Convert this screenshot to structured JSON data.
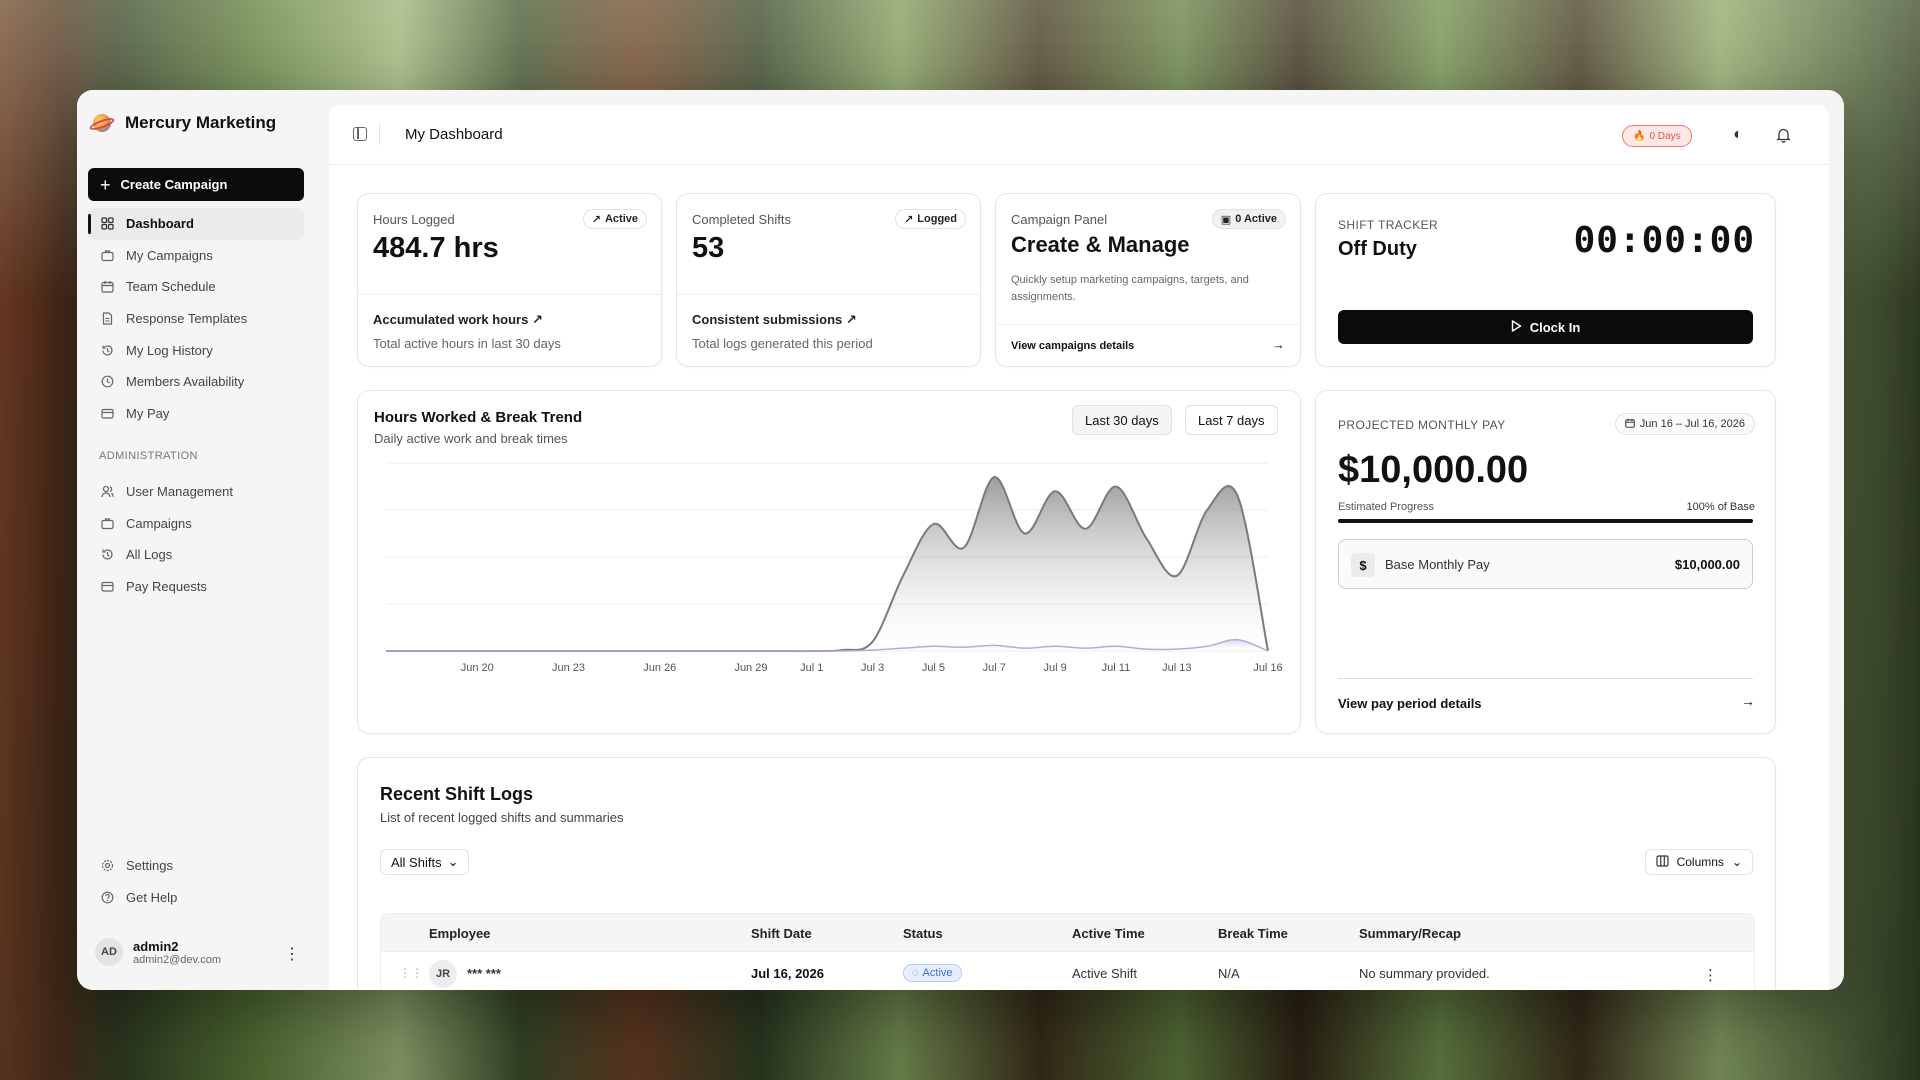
{
  "app": {
    "name": "Mercury Marketing"
  },
  "sidebar": {
    "create_label": "Create Campaign",
    "items": [
      {
        "label": "Dashboard",
        "icon": "grid-icon"
      },
      {
        "label": "My Campaigns",
        "icon": "briefcase-icon"
      },
      {
        "label": "Team Schedule",
        "icon": "calendar-icon"
      },
      {
        "label": "Response Templates",
        "icon": "document-icon"
      },
      {
        "label": "My Log History",
        "icon": "history-icon"
      },
      {
        "label": "Members Availability",
        "icon": "clock-icon"
      },
      {
        "label": "My Pay",
        "icon": "card-icon"
      }
    ],
    "admin_section_label": "ADMINISTRATION",
    "admin_items": [
      {
        "label": "User Management",
        "icon": "users-icon"
      },
      {
        "label": "Campaigns",
        "icon": "briefcase-icon"
      },
      {
        "label": "All Logs",
        "icon": "history-icon"
      },
      {
        "label": "Pay Requests",
        "icon": "card-icon"
      }
    ],
    "bottom_items": [
      {
        "label": "Settings",
        "icon": "gear-icon"
      },
      {
        "label": "Get Help",
        "icon": "help-icon"
      }
    ],
    "user": {
      "initials": "AD",
      "name": "admin2",
      "email": "admin2@dev.com"
    }
  },
  "header": {
    "title": "My Dashboard",
    "streak_label": "0 Days"
  },
  "stats": {
    "hours": {
      "label": "Hours Logged",
      "badge": "Active",
      "value": "484.7 hrs",
      "sub": "Accumulated work hours",
      "desc": "Total active hours in last 30 days"
    },
    "shifts": {
      "label": "Completed Shifts",
      "badge": "Logged",
      "value": "53",
      "sub": "Consistent submissions",
      "desc": "Total logs generated this period"
    }
  },
  "campaign_panel": {
    "label": "Campaign Panel",
    "badge": "0 Active",
    "title": "Create & Manage",
    "desc": "Quickly setup marketing campaigns, targets, and assignments.",
    "link": "View campaigns details"
  },
  "shift_tracker": {
    "label": "SHIFT TRACKER",
    "status": "Off Duty",
    "time": "00:00:00",
    "button": "Clock In"
  },
  "chart_card": {
    "title": "Hours Worked & Break Trend",
    "subtitle": "Daily active work and break times",
    "range_30": "Last 30 days",
    "range_7": "Last 7 days"
  },
  "chart_data": {
    "type": "area",
    "x_ticks": [
      "Jun 20",
      "Jun 23",
      "Jun 26",
      "Jun 29",
      "Jul 1",
      "Jul 3",
      "Jul 5",
      "Jul 7",
      "Jul 9",
      "Jul 11",
      "Jul 13",
      "Jul 16"
    ],
    "x": [
      "Jun 17",
      "Jun 18",
      "Jun 19",
      "Jun 20",
      "Jun 21",
      "Jun 22",
      "Jun 23",
      "Jun 24",
      "Jun 25",
      "Jun 26",
      "Jun 27",
      "Jun 28",
      "Jun 29",
      "Jun 30",
      "Jul 1",
      "Jul 2",
      "Jul 3",
      "Jul 4",
      "Jul 5",
      "Jul 6",
      "Jul 7",
      "Jul 8",
      "Jul 9",
      "Jul 10",
      "Jul 11",
      "Jul 12",
      "Jul 13",
      "Jul 14",
      "Jul 15",
      "Jul 16"
    ],
    "ylim": [
      0,
      20
    ],
    "grid": true,
    "legend": "none",
    "series": [
      {
        "values": [
          0,
          0,
          0,
          0,
          0,
          0,
          0,
          0,
          0,
          0,
          0,
          0,
          0,
          0,
          0,
          0.1,
          1,
          8,
          13.5,
          11,
          18.5,
          12.5,
          17,
          13,
          17.5,
          12,
          8,
          15,
          16.5,
          0
        ],
        "color": "#7a7a7a"
      },
      {
        "values": [
          0,
          0,
          0,
          0,
          0,
          0,
          0,
          0,
          0,
          0,
          0,
          0,
          0,
          0,
          0,
          0,
          0.1,
          0.3,
          0.5,
          0.4,
          0.6,
          0.3,
          0.5,
          0.3,
          0.5,
          0.2,
          0.2,
          0.5,
          1.2,
          0
        ],
        "color": "#b9a8d8"
      }
    ]
  },
  "pay": {
    "label": "PROJECTED MONTHLY PAY",
    "range": "Jun 16 – Jul 16, 2026",
    "value": "$10,000.00",
    "progress_label": "Estimated Progress",
    "progress_pct_label": "100% of Base",
    "progress": 1.0,
    "base_label": "Base Monthly Pay",
    "base_value": "$10,000.00",
    "link": "View pay period details"
  },
  "logs": {
    "title": "Recent Shift Logs",
    "subtitle": "List of recent logged shifts and summaries",
    "filter": "All Shifts",
    "columns_label": "Columns",
    "headers": [
      "Employee",
      "Shift Date",
      "Status",
      "Active Time",
      "Break Time",
      "Summary/Recap"
    ],
    "rows": [
      {
        "initials": "JR",
        "name": "*** ***",
        "date": "Jul 16, 2026",
        "status": "Active",
        "active_time": "Active Shift",
        "break_time": "N/A",
        "summary": "No summary provided."
      }
    ]
  }
}
